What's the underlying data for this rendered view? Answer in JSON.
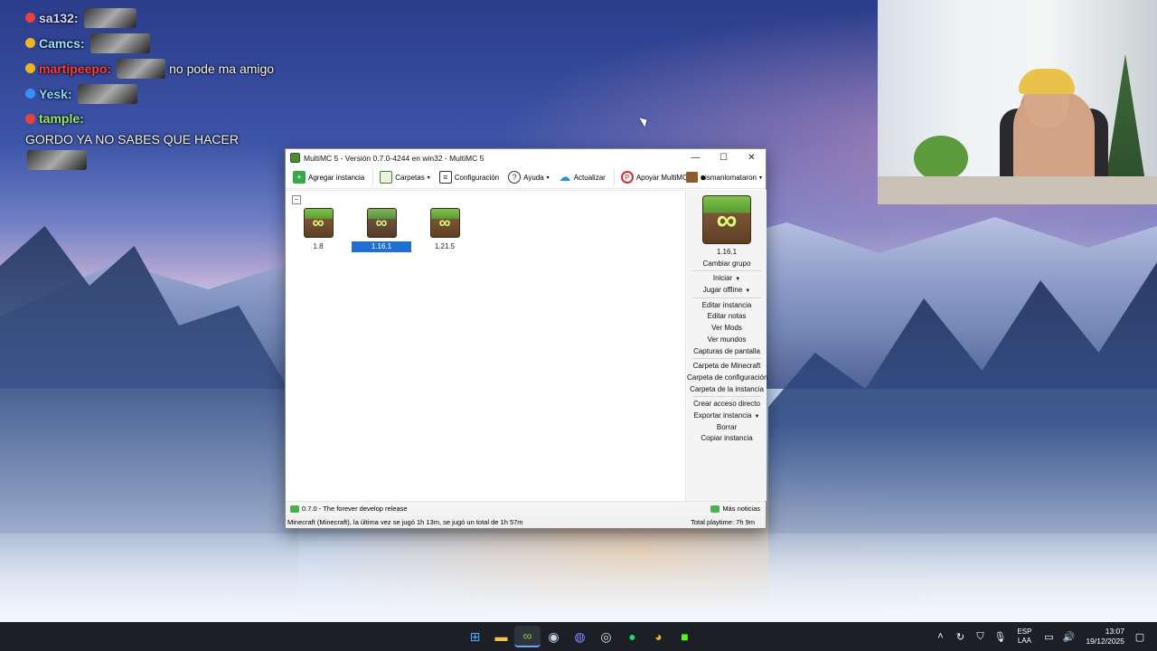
{
  "chat": [
    {
      "user": "sa​132:",
      "text": "",
      "user_color": "#d9d9ff",
      "badge_color": "#e8423a"
    },
    {
      "user": "Camcs:",
      "text": "",
      "user_color": "#9fe3ff",
      "badge_color": "#f3b51b"
    },
    {
      "user": "martipeepo:",
      "text": "no pode ma amigo",
      "user_color": "#ff3b3b",
      "badge_color": "#f3b51b"
    },
    {
      "user": "Yesk:",
      "text": "",
      "user_color": "#8fd4ff",
      "badge_color": "#3a8dff"
    },
    {
      "user": "tample:",
      "text": "GORDO YA NO SABES QUE HACER",
      "user_color": "#9be56d",
      "badge_color": "#e8423a"
    }
  ],
  "window": {
    "title": "MultiMC 5 - Versión 0.7.0-4244 en win32 - MultiMC 5",
    "controls": {
      "minimize": "—",
      "maximize": "☐",
      "close": "✕"
    }
  },
  "toolbar": {
    "add_instance": "Agregar instancia",
    "folders": "Carpetas",
    "settings": "Configuración",
    "help": "Ayuda",
    "update": "Actualizar",
    "support": "Apoyar MultiMC",
    "account": "nismanlomataron"
  },
  "instances": [
    {
      "name": "1.8",
      "selected": false
    },
    {
      "name": "1.16.1",
      "selected": true
    },
    {
      "name": "1.21.5",
      "selected": false
    }
  ],
  "sidebar": {
    "instance_name": "1.16.1",
    "change_group": "Cambiar grupo",
    "launch": "Iniciar",
    "launch_offline": "Jugar offline",
    "edit_instance": "Editar instancia",
    "edit_notes": "Editar notas",
    "view_mods": "Ver Mods",
    "view_worlds": "Ver mundos",
    "screenshots": "Capturas de pantalla",
    "mc_folder": "Carpeta de Minecraft",
    "config_folder": "Carpeta de configuración",
    "instance_folder": "Carpeta de la instancia",
    "create_shortcut": "Crear acceso directo",
    "export_instance": "Exportar instancia",
    "delete": "Borrar",
    "copy_instance": "Copiar instancia"
  },
  "status": {
    "news": "0.7.0 - The forever develop release",
    "more_news": "Más noticias",
    "played": "Minecraft (Minecraft), la última vez se jugó 1h 13m, se jugó un total de 1h 57m",
    "total": "Total playtime: 7h 9m"
  },
  "taskbar": {
    "lang_line1": "ESP",
    "lang_line2": "LAA",
    "time": "13:07",
    "date": "19/12/2025"
  }
}
